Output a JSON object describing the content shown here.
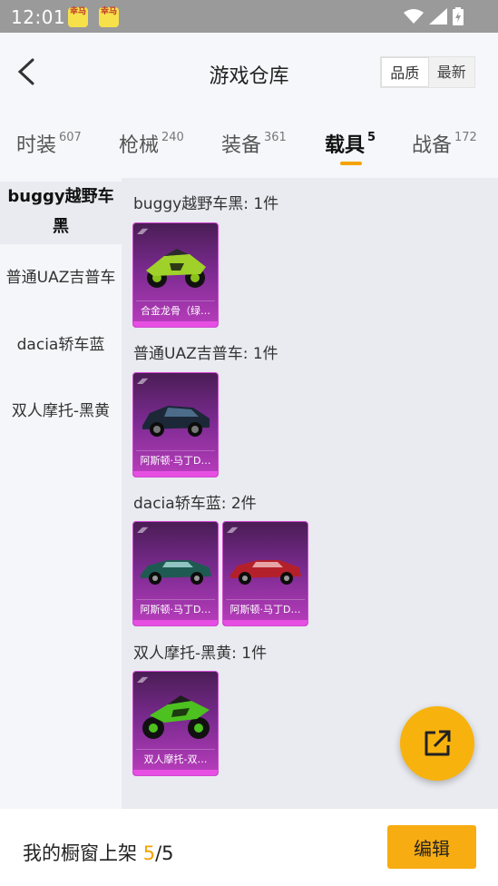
{
  "status_bar": {
    "time": "12:01",
    "app_icon_text": "幸马",
    "icons": [
      "wifi-icon",
      "signal-icon",
      "battery-icon"
    ]
  },
  "header": {
    "back_icon": "chevron-left-icon",
    "title": "游戏仓库",
    "sort_options": [
      "品质",
      "最新"
    ],
    "sort_selected": "品质"
  },
  "tabs": [
    {
      "label": "时装",
      "count": "607"
    },
    {
      "label": "枪械",
      "count": "240"
    },
    {
      "label": "装备",
      "count": "361"
    },
    {
      "label": "载具",
      "count": "5",
      "active": true
    },
    {
      "label": "战备",
      "count": "172"
    }
  ],
  "sidebar": {
    "items": [
      {
        "label": "buggy越野车黑",
        "active": true
      },
      {
        "label": "普通UAZ吉普车"
      },
      {
        "label": "dacia轿车蓝"
      },
      {
        "label": "双人摩托-黑黄"
      }
    ]
  },
  "groups": [
    {
      "title": "buggy越野车黑: 1件",
      "items": [
        {
          "name": "合金龙骨（绿…",
          "icon": "buggy-car-icon"
        }
      ]
    },
    {
      "title": "普通UAZ吉普车: 1件",
      "items": [
        {
          "name": "阿斯顿·马丁D…",
          "icon": "suv-car-icon"
        }
      ]
    },
    {
      "title": "dacia轿车蓝: 2件",
      "items": [
        {
          "name": "阿斯顿·马丁D…",
          "icon": "sports-car-icon"
        },
        {
          "name": "阿斯顿·马丁D…",
          "icon": "sports-car-icon"
        }
      ]
    },
    {
      "title": "双人摩托-黑黄: 1件",
      "items": [
        {
          "name": "双人摩托-双…",
          "icon": "motorcycle-icon"
        }
      ]
    }
  ],
  "fab": {
    "icon": "share-icon"
  },
  "bottom_bar": {
    "label_prefix": "我的橱窗上架",
    "used": "5",
    "separator_total": "/5",
    "edit_label": "编辑"
  },
  "colors": {
    "accent": "#f5a300",
    "card_gradient_top": "#4a1d55",
    "card_gradient_bottom": "#b93dbd"
  }
}
